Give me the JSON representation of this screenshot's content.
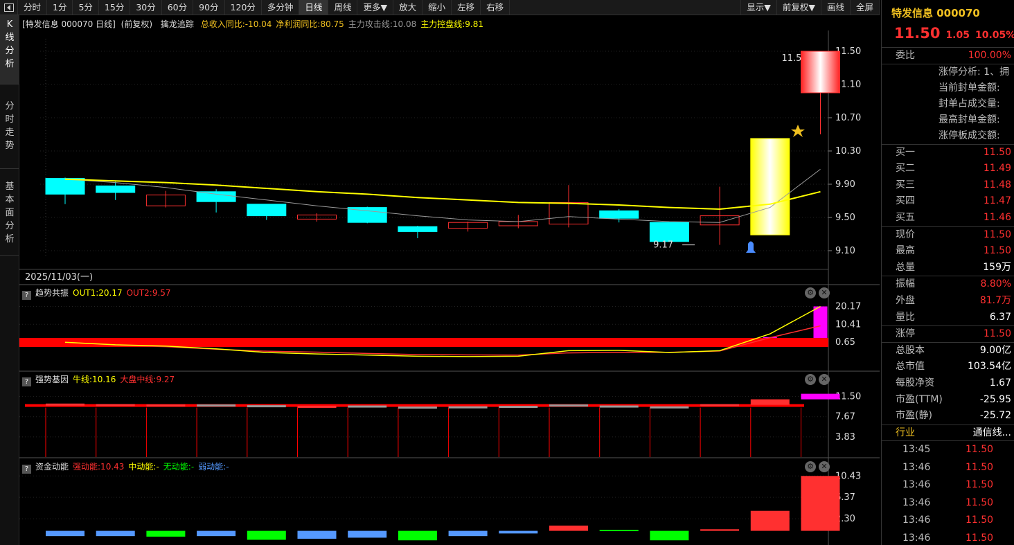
{
  "toolbar": {
    "items": [
      "分时",
      "1分",
      "5分",
      "15分",
      "30分",
      "60分",
      "90分",
      "120分",
      "多分钟",
      "日线",
      "周线",
      "更多▼",
      "放大",
      "缩小",
      "左移",
      "右移"
    ],
    "active": "日线",
    "right_items": [
      "显示▼",
      "前复权▼",
      "画线",
      "全屏"
    ]
  },
  "left_tabs": [
    {
      "label": "K线分析",
      "active": true
    },
    {
      "label": "分时走势",
      "active": false
    },
    {
      "label": "基本面分析",
      "active": false
    }
  ],
  "colors": {
    "up": "#ff3030",
    "down": "#00ffff",
    "yellow": "#ffff00",
    "gray": "#9a9a9a",
    "magenta": "#ff00ff",
    "green": "#00ff00",
    "blue": "#5599ff",
    "accent": "#f0c020"
  },
  "main_panel": {
    "label_title": "[特发信息 000070 日线]",
    "label_adj": "(前复权)",
    "indicator": "擒龙追踪",
    "items": [
      {
        "text": "总收入同比:-10.04",
        "color": "#f0c020"
      },
      {
        "text": "净利润同比:80.75",
        "color": "#f0c020"
      },
      {
        "text": "主力攻击线:10.08",
        "color": "#9a9a9a"
      },
      {
        "text": "主力控盘线:9.81",
        "color": "#ffff00"
      }
    ],
    "date_label": "2025/11/03(一)",
    "low_label": "9.17",
    "high_label": "11.5"
  },
  "panel2": {
    "name": "趋势共振",
    "items": [
      {
        "text": "OUT1:20.17",
        "color": "#ffff00"
      },
      {
        "text": "OUT2:9.57",
        "color": "#ff3030"
      }
    ]
  },
  "panel3": {
    "name": "强势基因",
    "items": [
      {
        "text": "牛线:10.16",
        "color": "#ffff00"
      },
      {
        "text": "大盘中线:9.27",
        "color": "#ff3030"
      }
    ]
  },
  "panel4": {
    "name": "资金动能",
    "items": [
      {
        "text": "强动能:10.43",
        "color": "#ff3030"
      },
      {
        "text": "中动能:-",
        "color": "#ffff00"
      },
      {
        "text": "无动能:-",
        "color": "#00ff00"
      },
      {
        "text": "弱动能:-",
        "color": "#5599ff"
      }
    ]
  },
  "chart_data": [
    {
      "type": "candlestick",
      "panel": "main",
      "y_ticks": [
        11.5,
        11.1,
        10.7,
        10.3,
        9.9,
        9.5,
        9.1
      ],
      "ylim": [
        9.0,
        11.65
      ],
      "candles": [
        {
          "o": 9.97,
          "h": 9.98,
          "l": 9.66,
          "c": 9.78
        },
        {
          "o": 9.88,
          "h": 9.93,
          "l": 9.71,
          "c": 9.8
        },
        {
          "o": 9.64,
          "h": 9.82,
          "l": 9.62,
          "c": 9.77
        },
        {
          "o": 9.81,
          "h": 9.84,
          "l": 9.56,
          "c": 9.69
        },
        {
          "o": 9.66,
          "h": 9.66,
          "l": 9.47,
          "c": 9.52
        },
        {
          "o": 9.48,
          "h": 9.55,
          "l": 9.45,
          "c": 9.53
        },
        {
          "o": 9.62,
          "h": 9.63,
          "l": 9.43,
          "c": 9.44
        },
        {
          "o": 9.39,
          "h": 9.4,
          "l": 9.25,
          "c": 9.33
        },
        {
          "o": 9.37,
          "h": 9.45,
          "l": 9.33,
          "c": 9.44
        },
        {
          "o": 9.4,
          "h": 9.53,
          "l": 9.37,
          "c": 9.45
        },
        {
          "o": 9.42,
          "h": 9.89,
          "l": 9.38,
          "c": 9.68
        },
        {
          "o": 9.58,
          "h": 9.6,
          "l": 9.44,
          "c": 9.49
        },
        {
          "o": 9.44,
          "h": 9.44,
          "l": 9.21,
          "c": 9.21
        },
        {
          "o": 9.41,
          "h": 9.87,
          "l": 9.17,
          "c": 9.52
        },
        {
          "o": 9.29,
          "h": 10.45,
          "l": 9.29,
          "c": 10.45
        },
        {
          "o": 11.0,
          "h": 11.5,
          "l": 10.5,
          "c": 11.5
        }
      ],
      "ma_yellow": [
        9.96,
        9.94,
        9.92,
        9.89,
        9.85,
        9.81,
        9.78,
        9.74,
        9.71,
        9.68,
        9.67,
        9.65,
        9.62,
        9.6,
        9.66,
        9.81
      ],
      "ma_gray": [
        9.96,
        9.92,
        9.86,
        9.78,
        9.71,
        9.64,
        9.58,
        9.52,
        9.47,
        9.45,
        9.51,
        9.48,
        9.45,
        9.44,
        9.62,
        10.08
      ]
    },
    {
      "type": "line",
      "panel": "趋势共振",
      "y_ticks": [
        20.17,
        10.41,
        0.65
      ],
      "ylim": [
        -6.5,
        23.0
      ],
      "out1": [
        0.6,
        -0.8,
        -1.5,
        -3.0,
        -5.0,
        -5.8,
        -6.4,
        -7.0,
        -7.2,
        -7.0,
        -4.0,
        -3.8,
        -5.0,
        -4.0,
        5.2,
        20.17
      ],
      "out2": [
        0.6,
        -0.9,
        -1.8,
        -3.2,
        -4.3,
        -4.8,
        -5.5,
        -6.1,
        -6.3,
        -6.4,
        -5.2,
        -4.9,
        -4.9,
        -4.2,
        3.1,
        9.57
      ],
      "band": 0.65,
      "bars": [
        {
          "i": 14,
          "v": 3.4
        },
        {
          "i": 15,
          "v": 20.17
        }
      ]
    },
    {
      "type": "bar",
      "panel": "强势基因",
      "y_ticks": [
        11.5,
        7.67,
        3.83
      ],
      "ylim": [
        0,
        12.9
      ],
      "bars": [
        {
          "v": 9.97,
          "c": "up"
        },
        {
          "v": 9.88,
          "c": "up"
        },
        {
          "v": 9.8,
          "c": "up"
        },
        {
          "v": 9.8,
          "c": "gray"
        },
        {
          "v": 9.66,
          "c": "gray"
        },
        {
          "v": 9.55,
          "c": "up"
        },
        {
          "v": 9.6,
          "c": "gray"
        },
        {
          "v": 9.4,
          "c": "gray"
        },
        {
          "v": 9.45,
          "c": "gray"
        },
        {
          "v": 9.53,
          "c": "gray"
        },
        {
          "v": 9.8,
          "c": "gray"
        },
        {
          "v": 9.6,
          "c": "gray"
        },
        {
          "v": 9.44,
          "c": "gray"
        },
        {
          "v": 9.87,
          "c": "up"
        },
        {
          "v": 10.45,
          "c": "up"
        },
        {
          "v": 11.5,
          "c": "magenta"
        }
      ]
    },
    {
      "type": "bar",
      "panel": "资金动能",
      "y_ticks": [
        10.43,
        6.37,
        2.3
      ],
      "ylim": [
        -1.9,
        10.6
      ],
      "bars": [
        {
          "v": -1.0,
          "c": "blue"
        },
        {
          "v": -1.0,
          "c": "blue"
        },
        {
          "v": -1.1,
          "c": "green"
        },
        {
          "v": -1.0,
          "c": "blue"
        },
        {
          "v": -1.7,
          "c": "green"
        },
        {
          "v": -1.5,
          "c": "blue"
        },
        {
          "v": -1.3,
          "c": "blue"
        },
        {
          "v": -1.8,
          "c": "green"
        },
        {
          "v": -1.0,
          "c": "blue"
        },
        {
          "v": -0.5,
          "c": "blue"
        },
        {
          "v": 1.0,
          "c": "up"
        },
        {
          "v": 0.2,
          "c": "green"
        },
        {
          "v": -1.8,
          "c": "green"
        },
        {
          "v": 0.3,
          "c": "up"
        },
        {
          "v": 3.8,
          "c": "up"
        },
        {
          "v": 10.43,
          "c": "up"
        }
      ]
    }
  ],
  "right_panel": {
    "title": "特发信息 000070",
    "price": "11.50",
    "change": "1.05",
    "change_pct": "10.05%",
    "weibi_label": "委比",
    "weibi_value": "100.00%",
    "limit_lines": [
      "涨停分析: 1、拥",
      "当前封单金额:",
      "封单占成交量:",
      "最高封单金额:",
      "涨停板成交额:"
    ],
    "bids": [
      {
        "label": "买一",
        "price": "11.50"
      },
      {
        "label": "买二",
        "price": "11.49"
      },
      {
        "label": "买三",
        "price": "11.48"
      },
      {
        "label": "买四",
        "price": "11.47"
      },
      {
        "label": "买五",
        "price": "11.46"
      }
    ],
    "quote": [
      {
        "label": "现价",
        "value": "11.50",
        "color": "#ff3030"
      },
      {
        "label": "最高",
        "value": "11.50",
        "color": "#ff3030"
      },
      {
        "label": "总量",
        "value": "159万",
        "color": "#ffffff"
      }
    ],
    "quote2": [
      {
        "label": "振幅",
        "value": "8.80%",
        "color": "#ff3030"
      },
      {
        "label": "外盘",
        "value": "81.7万",
        "color": "#ff3030"
      },
      {
        "label": "量比",
        "value": "6.37",
        "color": "#ffffff"
      }
    ],
    "limit_up": {
      "label": "涨停",
      "value": "11.50"
    },
    "fundamentals": [
      {
        "label": "总股本",
        "value": "9.00亿"
      },
      {
        "label": "总市值",
        "value": "103.54亿"
      },
      {
        "label": "每股净资",
        "value": "1.67"
      },
      {
        "label": "市盈(TTM)",
        "value": "-25.95"
      },
      {
        "label": "市盈(静)",
        "value": "-25.72"
      }
    ],
    "industry": {
      "label": "行业",
      "value": "通信线..."
    },
    "ticks": [
      {
        "time": "13:45",
        "price": "11.50"
      },
      {
        "time": "13:46",
        "price": "11.50"
      },
      {
        "time": "13:46",
        "price": "11.50"
      },
      {
        "time": "13:46",
        "price": "11.50"
      },
      {
        "time": "13:46",
        "price": "11.50"
      },
      {
        "time": "13:46",
        "price": "11.50"
      }
    ]
  }
}
